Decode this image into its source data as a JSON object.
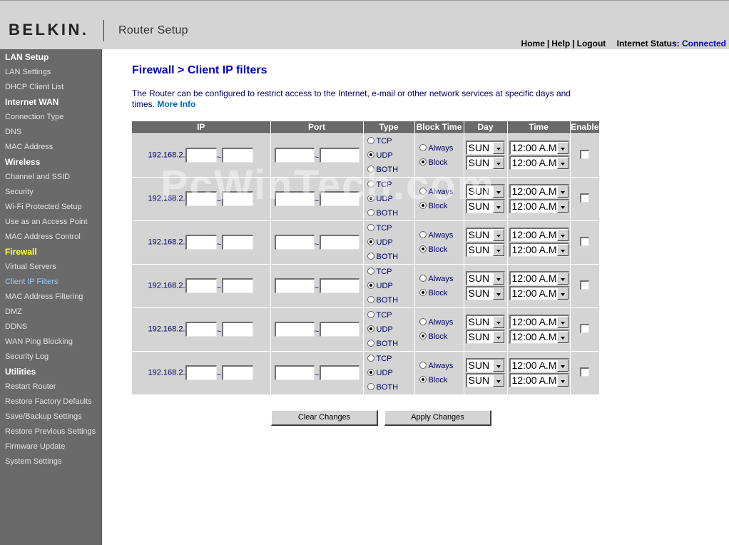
{
  "header": {
    "logo": "BELKIN.",
    "app_title": "Router Setup",
    "nav": {
      "home": "Home",
      "help": "Help",
      "logout": "Logout",
      "sep": "|"
    },
    "status_label": "Internet Status:",
    "status_value": "Connected"
  },
  "sidebar": {
    "sections": [
      {
        "heading": "LAN Setup",
        "items": [
          "LAN Settings",
          "DHCP Client List"
        ]
      },
      {
        "heading": "Internet WAN",
        "items": [
          "Connection Type",
          "DNS",
          "MAC Address"
        ]
      },
      {
        "heading": "Wireless",
        "items": [
          "Channel and SSID",
          "Security",
          "Wi-Fi Protected Setup",
          "Use as an Access Point",
          "MAC Address Control"
        ]
      },
      {
        "heading": "Firewall",
        "items": [
          "Virtual Servers",
          "Client IP Filters",
          "MAC Address Filtering",
          "DMZ",
          "DDNS",
          "WAN Ping Blocking",
          "Security Log"
        ]
      },
      {
        "heading": "Utilities",
        "items": [
          "Restart Router",
          "Restore Factory Defaults",
          "Save/Backup Settings",
          "Restore Previous Settings",
          "Firmware Update",
          "System Settings"
        ]
      }
    ],
    "active_section": "Firewall",
    "active_item": "Client IP Filters"
  },
  "main": {
    "title": "Firewall > Client IP filters",
    "description": "The Router can be configured to restrict access to the Internet, e-mail or other network services at specific days and times.",
    "more_info": "More Info",
    "watermark": "PcWinTech.com",
    "table": {
      "headers": {
        "ip": "IP",
        "port": "Port",
        "type": "Type",
        "block_time": "Block Time",
        "day": "Day",
        "time": "Time",
        "enable": "Enable"
      },
      "ip_prefix": "192.168.2.",
      "range_separator": "~",
      "type_options": [
        "TCP",
        "UDP",
        "BOTH"
      ],
      "block_time_options": [
        "Always",
        "Block"
      ],
      "rows": [
        {
          "ip_start": "",
          "ip_end": "",
          "port_start": "",
          "port_end": "",
          "type": "UDP",
          "block_time": "Block",
          "day_start": "SUN",
          "day_end": "SUN",
          "time_start": "12:00 A.M.",
          "time_end": "12:00 A.M.",
          "enabled": false
        },
        {
          "ip_start": "",
          "ip_end": "",
          "port_start": "",
          "port_end": "",
          "type": "UDP",
          "block_time": "Block",
          "day_start": "SUN",
          "day_end": "SUN",
          "time_start": "12:00 A.M.",
          "time_end": "12:00 A.M.",
          "enabled": false
        },
        {
          "ip_start": "",
          "ip_end": "",
          "port_start": "",
          "port_end": "",
          "type": "UDP",
          "block_time": "Block",
          "day_start": "SUN",
          "day_end": "SUN",
          "time_start": "12:00 A.M.",
          "time_end": "12:00 A.M.",
          "enabled": false
        },
        {
          "ip_start": "",
          "ip_end": "",
          "port_start": "",
          "port_end": "",
          "type": "UDP",
          "block_time": "Block",
          "day_start": "SUN",
          "day_end": "SUN",
          "time_start": "12:00 A.M.",
          "time_end": "12:00 A.M.",
          "enabled": false
        },
        {
          "ip_start": "",
          "ip_end": "",
          "port_start": "",
          "port_end": "",
          "type": "UDP",
          "block_time": "Block",
          "day_start": "SUN",
          "day_end": "SUN",
          "time_start": "12:00 A.M.",
          "time_end": "12:00 A.M.",
          "enabled": false
        },
        {
          "ip_start": "",
          "ip_end": "",
          "port_start": "",
          "port_end": "",
          "type": "UDP",
          "block_time": "Block",
          "day_start": "SUN",
          "day_end": "SUN",
          "time_start": "12:00 A.M.",
          "time_end": "12:00 A.M.",
          "enabled": false
        }
      ]
    },
    "buttons": {
      "clear": "Clear Changes",
      "apply": "Apply Changes"
    }
  },
  "colors": {
    "link_blue": "#0000cc",
    "header_gray": "#d4d4d4",
    "sidebar_gray": "#6a6a6a",
    "active_section": "#ffff33",
    "active_item": "#99ccff"
  },
  "icons": {
    "select_arrow": "chevron-down-icon",
    "radio": "radio-icon",
    "checkbox": "checkbox-icon"
  }
}
